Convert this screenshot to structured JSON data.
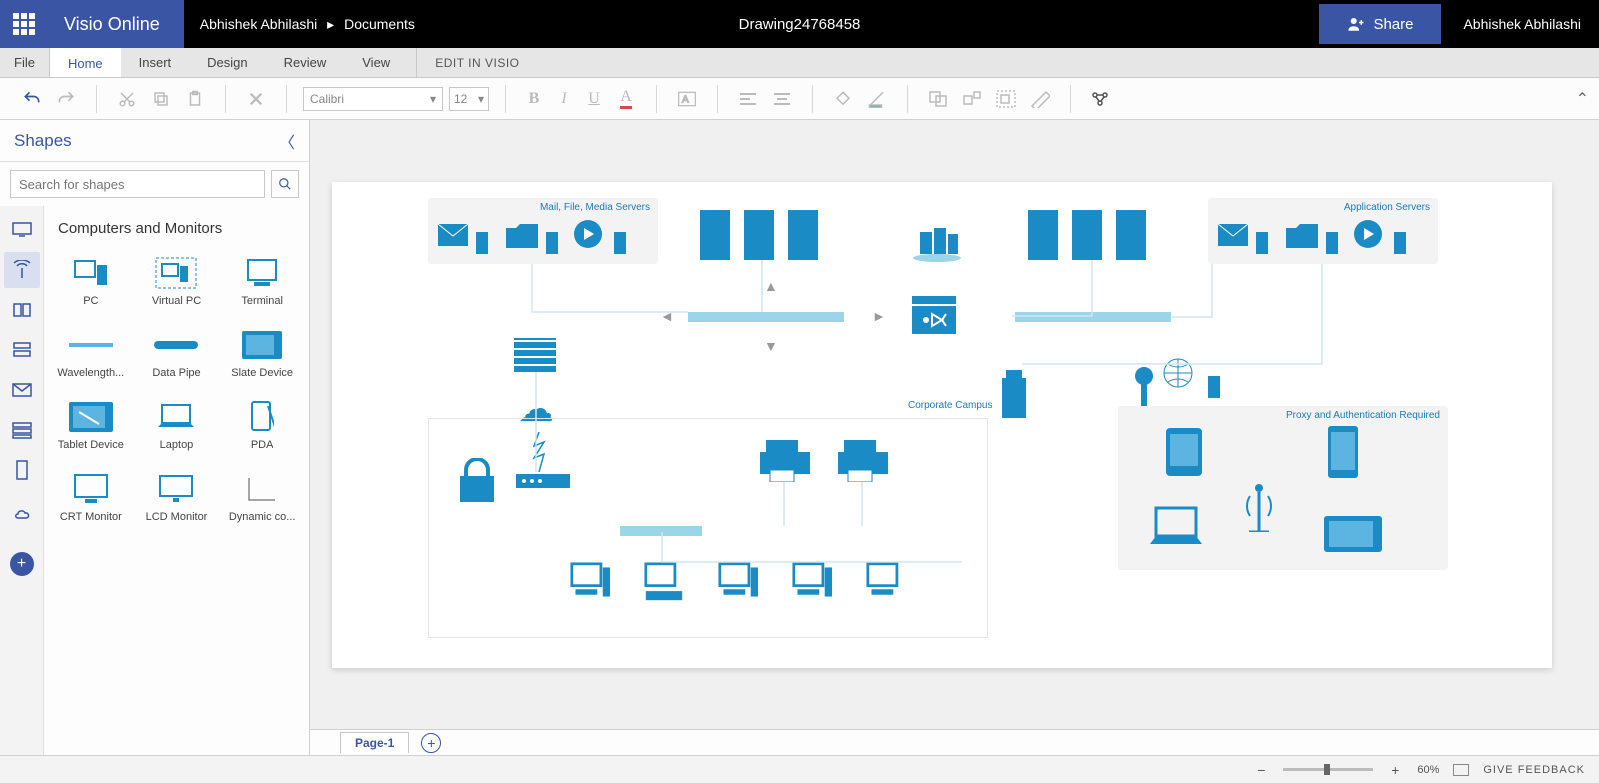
{
  "topbar": {
    "app_name": "Visio Online",
    "breadcrumb_user": "Abhishek Abhilashi",
    "breadcrumb_sep": "▸",
    "breadcrumb_loc": "Documents",
    "doc_title": "Drawing24768458",
    "share_label": "Share",
    "user_name": "Abhishek Abhilashi"
  },
  "menu": {
    "file": "File",
    "tabs": [
      "Home",
      "Insert",
      "Design",
      "Review",
      "View"
    ],
    "edit_in_visio": "EDIT IN VISIO"
  },
  "ribbon": {
    "font_name": "Calibri",
    "font_size": "12"
  },
  "shapes_panel": {
    "title": "Shapes",
    "search_placeholder": "Search for shapes",
    "stencil_title": "Computers and Monitors",
    "shapes": [
      {
        "label": "PC"
      },
      {
        "label": "Virtual PC"
      },
      {
        "label": "Terminal"
      },
      {
        "label": "Wavelength..."
      },
      {
        "label": "Data Pipe"
      },
      {
        "label": "Slate Device"
      },
      {
        "label": "Tablet Device"
      },
      {
        "label": "Laptop"
      },
      {
        "label": "PDA"
      },
      {
        "label": "CRT Monitor"
      },
      {
        "label": "LCD Monitor"
      },
      {
        "label": "Dynamic co..."
      }
    ]
  },
  "canvas": {
    "group1_title": "Mail, File, Media Servers",
    "group2_title": "Application Servers",
    "group3_title": "Proxy and Authentication Required",
    "label_campus": "Corporate Campus"
  },
  "page_tabs": {
    "page1": "Page-1"
  },
  "statusbar": {
    "zoom": "60%",
    "feedback": "GIVE FEEDBACK"
  }
}
